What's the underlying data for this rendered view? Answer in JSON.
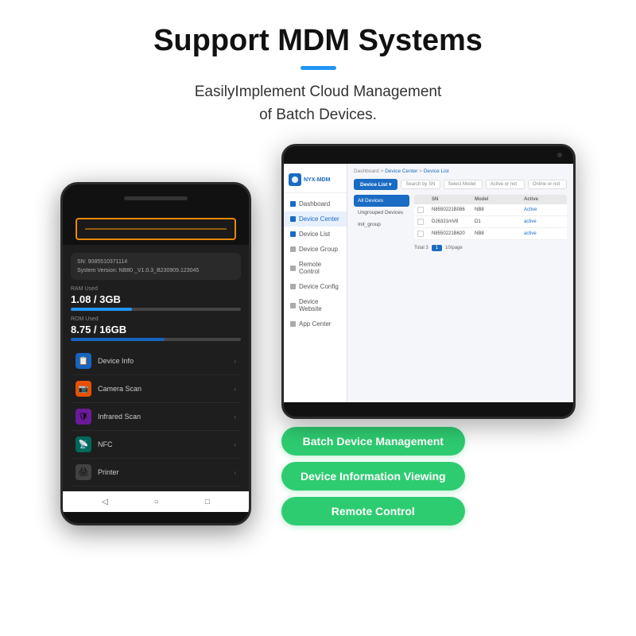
{
  "header": {
    "title": "Support MDM Systems",
    "subtitle": "EasilyImplement Cloud Management\nof Batch Devices."
  },
  "phone": {
    "sn_label": "SN: 9085510371114",
    "version_label": "System Version: NB80 _V1.0.3_B230909.123045",
    "ram_label": "RAM Used",
    "ram_value": "1.08 / 3GB",
    "ram_percent": 36,
    "rom_label": "ROM Used",
    "rom_value": "8.75 / 16GB",
    "rom_percent": 55,
    "menu_items": [
      {
        "label": "Device Info",
        "icon": "📋"
      },
      {
        "label": "Camera Scan",
        "icon": "📷"
      },
      {
        "label": "Infrared Scan",
        "icon": "🛡"
      },
      {
        "label": "NFC",
        "icon": "📡"
      },
      {
        "label": "Printer",
        "icon": "🖨"
      }
    ]
  },
  "tablet": {
    "logo": "NYX-MDM",
    "breadcrumb": "Dashboard > Device Center > Device List",
    "device_list_btn": "Device List ▾",
    "filters": [
      "Search by SN",
      "Select Model",
      "Active or not",
      "Online or not"
    ],
    "groups": [
      "All Devices",
      "Ungrouped Devices",
      "Init_group"
    ],
    "table_headers": [
      "",
      "SN",
      "Model",
      "Active"
    ],
    "table_rows": [
      {
        "sn": "N8550221B086",
        "model": "NB8",
        "active": "Active"
      },
      {
        "sn": "D26321mV8",
        "model": "D1",
        "active": "active"
      },
      {
        "sn": "N8550221B620",
        "model": "NB8",
        "active": "active"
      }
    ],
    "pagination": "Total 3",
    "sidebar_items": [
      "Dashboard",
      "Device Center",
      "Device List",
      "Device Group",
      "Remote Control",
      "Device Config",
      "Device Website",
      "App Center"
    ]
  },
  "badges": [
    "Batch Device Management",
    "Device Information Viewing",
    "Remote Control"
  ]
}
